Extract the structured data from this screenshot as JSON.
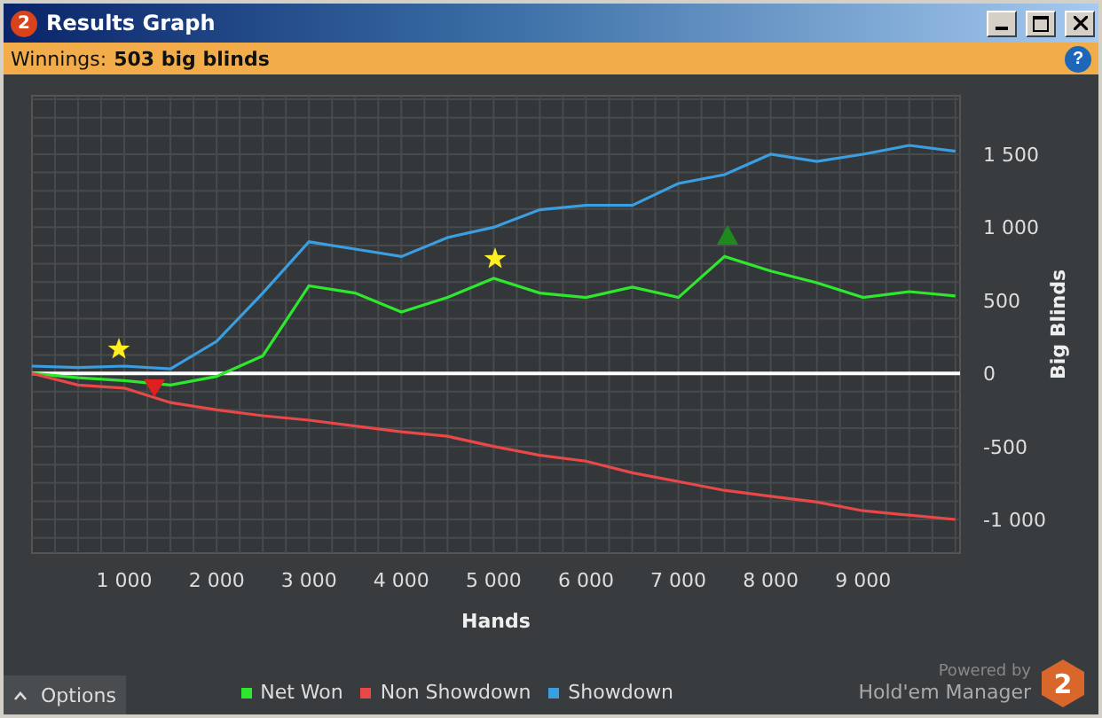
{
  "window": {
    "title": "Results Graph",
    "badge": "2"
  },
  "summary": {
    "label": "Winnings:",
    "value": "503 big blinds",
    "help": "?"
  },
  "graph": {
    "chart_data": {
      "type": "line",
      "xlabel": "Hands",
      "ylabel": "Big Blinds",
      "xlim": [
        0,
        10050
      ],
      "ylim": [
        -1230,
        1900
      ],
      "x": [
        0,
        500,
        1000,
        1500,
        2000,
        2500,
        3000,
        3500,
        4000,
        4500,
        5000,
        5500,
        6000,
        6500,
        7000,
        7500,
        8000,
        8500,
        9000,
        9500,
        10000
      ],
      "xticks": [
        {
          "value": 1000,
          "label": "1 000"
        },
        {
          "value": 2000,
          "label": "2 000"
        },
        {
          "value": 3000,
          "label": "3 000"
        },
        {
          "value": 4000,
          "label": "4 000"
        },
        {
          "value": 5000,
          "label": "5 000"
        },
        {
          "value": 6000,
          "label": "6 000"
        },
        {
          "value": 7000,
          "label": "7 000"
        },
        {
          "value": 8000,
          "label": "8 000"
        },
        {
          "value": 9000,
          "label": "9 000"
        }
      ],
      "yticks": [
        {
          "value": 1500,
          "label": "1 500"
        },
        {
          "value": 1000,
          "label": "1 000"
        },
        {
          "value": 500,
          "label": "500"
        },
        {
          "value": 0,
          "label": "0"
        },
        {
          "value": -500,
          "label": "-500"
        },
        {
          "value": -1000,
          "label": "-1 000"
        }
      ],
      "series": [
        {
          "name": "Net Won",
          "color": "#2ee82e",
          "values": [
            0,
            -30,
            -50,
            -80,
            -20,
            120,
            600,
            550,
            420,
            520,
            650,
            550,
            520,
            590,
            520,
            800,
            700,
            620,
            520,
            560,
            530
          ]
        },
        {
          "name": "Non Showdown",
          "color": "#e84848",
          "values": [
            0,
            -80,
            -100,
            -200,
            -250,
            -290,
            -320,
            -360,
            -400,
            -430,
            -500,
            -560,
            -600,
            -680,
            -740,
            -800,
            -840,
            -880,
            -940,
            -970,
            -1000
          ]
        },
        {
          "name": "Showdown",
          "color": "#3a9ee0",
          "values": [
            50,
            40,
            50,
            30,
            220,
            550,
            900,
            850,
            800,
            930,
            1000,
            1120,
            1150,
            1150,
            1300,
            1360,
            1500,
            1450,
            1500,
            1560,
            1520
          ]
        }
      ],
      "grid": true
    }
  },
  "footer": {
    "options": "Options",
    "powered": "Powered by",
    "product": "Hold'em Manager",
    "logo": "2"
  }
}
